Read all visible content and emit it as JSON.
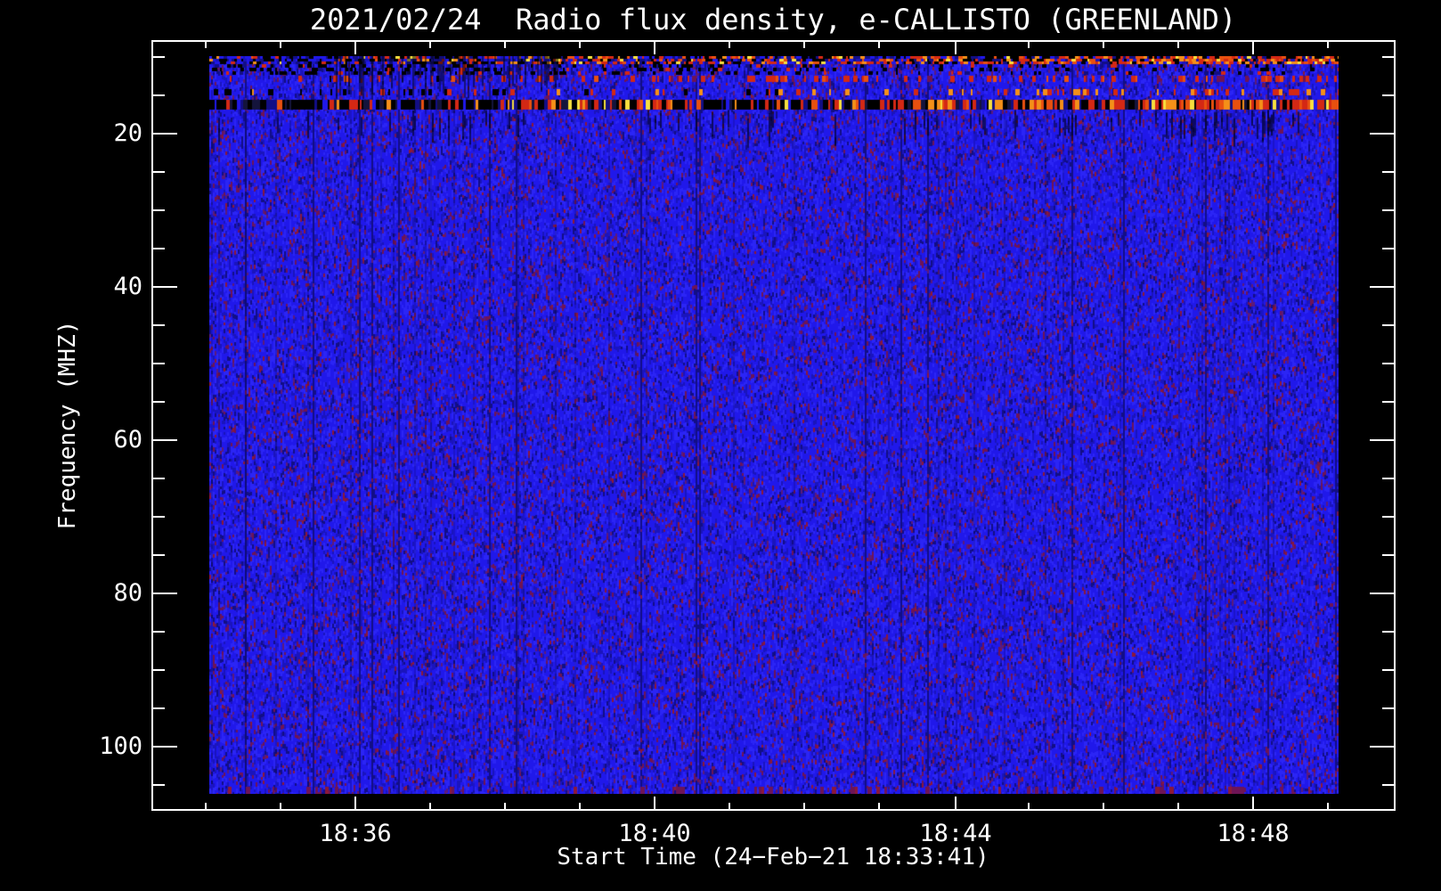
{
  "chart_data": {
    "type": "heatmap",
    "title": "2021/02/24  Radio flux density, e-CALLISTO (GREENLAND)",
    "date": "2021/02/24",
    "instrument": "e-CALLISTO",
    "station": "GREENLAND",
    "xlabel": "Start Time (24−Feb−21 18:33:41)",
    "ylabel": "Frequency (MHZ)",
    "x_tick_labels": [
      "18:36",
      "18:40",
      "18:44",
      "18:48"
    ],
    "y_tick_labels": [
      "20",
      "40",
      "60",
      "80",
      "100"
    ],
    "x_start_time": "18:33:41",
    "x_minor_tick_interval": "1 minute",
    "y_minor_tick_interval_mhz": 5,
    "y_axis_inverted": true,
    "y_data_range_mhz": [
      10,
      106
    ],
    "legend": "none",
    "grid": "off",
    "features": [
      {
        "freq_mhz": "10-11",
        "description": "patchy RFI lane; blue/black dashes early, increasingly red/orange/yellow toward later times"
      },
      {
        "freq_mhz": "12-13",
        "description": "weak lane of red flecks, stronger toward later times"
      },
      {
        "freq_mhz": "16-17",
        "description": "strong dark interference lane with bright red/orange/yellow bursts across all times"
      },
      {
        "freq_mhz": "18-22",
        "description": "blue noise with scattered dark vertical streaks, denser near 18:46-18:48"
      },
      {
        "freq_mhz": "22-106",
        "description": "uniform blue background noise with sparse dark-red/maroon speckles"
      }
    ],
    "palette": {
      "base_blue": "#2018ea",
      "bright_blue": "#2b25f5",
      "mid_blue": "#1a14bd",
      "navy": "#120e86",
      "deep_navy": "#14143c",
      "maroon": "#6e1455",
      "purple": "#5c1a7a",
      "dark_red": "#8c1838",
      "red": "#d42814",
      "orange_red": "#e8500f",
      "orange": "#f59018",
      "yellow": "#f8e03e",
      "black": "#000000",
      "axis_white": "#ffffff",
      "background": "#000000"
    }
  }
}
